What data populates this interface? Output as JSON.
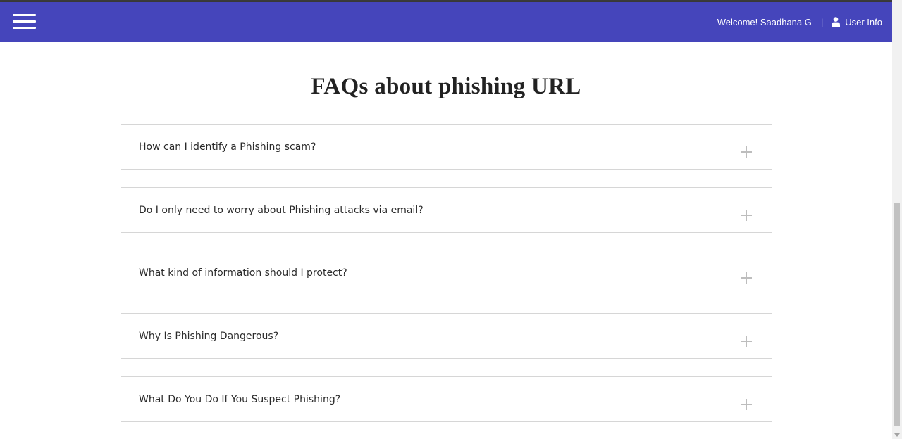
{
  "navbar": {
    "menu_icon": "hamburger-icon",
    "welcome_text": "Welcome! Saadhana G",
    "separator": "|",
    "user_icon": "user-icon",
    "user_info_label": "User Info",
    "background_color": "#4545bb"
  },
  "main": {
    "title": "FAQs about phishing URL",
    "faqs": [
      {
        "question": "How can I identify a Phishing scam?",
        "icon": "plus-icon"
      },
      {
        "question": "Do I only need to worry about Phishing attacks via email?",
        "icon": "plus-icon"
      },
      {
        "question": "What kind of information should I protect?",
        "icon": "plus-icon"
      },
      {
        "question": "Why Is Phishing Dangerous?",
        "icon": "plus-icon"
      },
      {
        "question": "What Do You Do If You Suspect Phishing?",
        "icon": "plus-icon"
      }
    ]
  }
}
